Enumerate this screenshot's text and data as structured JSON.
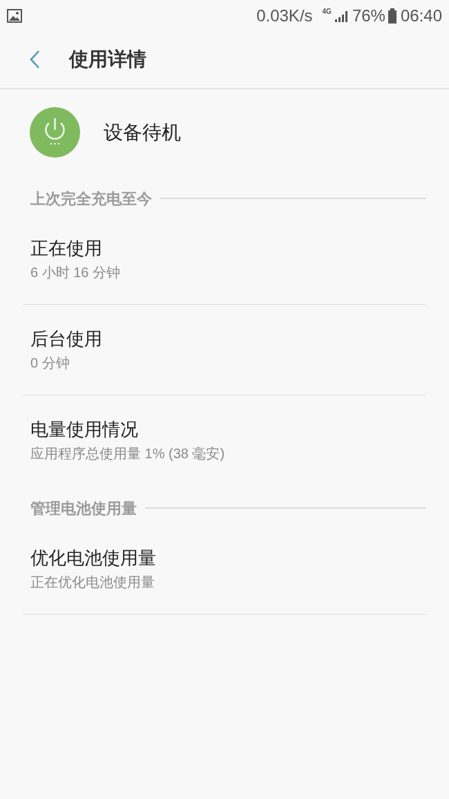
{
  "status_bar": {
    "speed": "0.03K/s",
    "network": "4G",
    "battery": "76%",
    "time": "06:40"
  },
  "header": {
    "title": "使用详情"
  },
  "app": {
    "name": "设备待机"
  },
  "sections": [
    {
      "title": "上次完全充电至今",
      "items": [
        {
          "title": "正在使用",
          "subtitle": "6 小时 16 分钟"
        },
        {
          "title": "后台使用",
          "subtitle": "0 分钟"
        },
        {
          "title": "电量使用情况",
          "subtitle": "应用程序总使用量 1% (38 毫安)"
        }
      ]
    },
    {
      "title": "管理电池使用量",
      "items": [
        {
          "title": "优化电池使用量",
          "subtitle": "正在优化电池使用量"
        }
      ]
    }
  ]
}
